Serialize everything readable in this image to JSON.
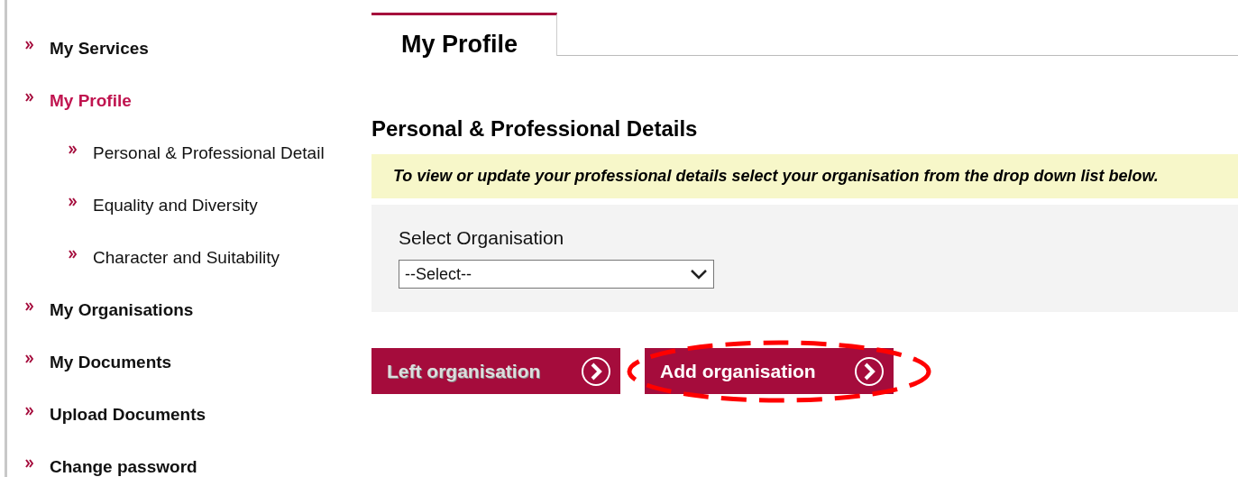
{
  "sidebar": {
    "items": [
      {
        "label": "My Services",
        "selected": false
      },
      {
        "label": "My Profile",
        "selected": true,
        "children": [
          {
            "label": "Personal & Professional Detail",
            "selected": false
          },
          {
            "label": "Equality and Diversity",
            "selected": false
          },
          {
            "label": "Character and Suitability",
            "selected": false
          }
        ]
      },
      {
        "label": "My Organisations",
        "selected": false
      },
      {
        "label": "My Documents",
        "selected": false
      },
      {
        "label": "Upload Documents",
        "selected": false
      },
      {
        "label": "Change password",
        "selected": false
      }
    ]
  },
  "tabs": [
    {
      "label": "My Profile",
      "selected": true
    }
  ],
  "heading": "Personal & Professional Details",
  "notice": "To view or update your professional details select your organisation from the drop down list below.",
  "select": {
    "label": "Select Organisation",
    "value": "--Select--"
  },
  "buttons": [
    {
      "label": "Left organisation",
      "disabled": true,
      "highlighted": false
    },
    {
      "label": "Add organisation",
      "disabled": false,
      "highlighted": true
    }
  ]
}
